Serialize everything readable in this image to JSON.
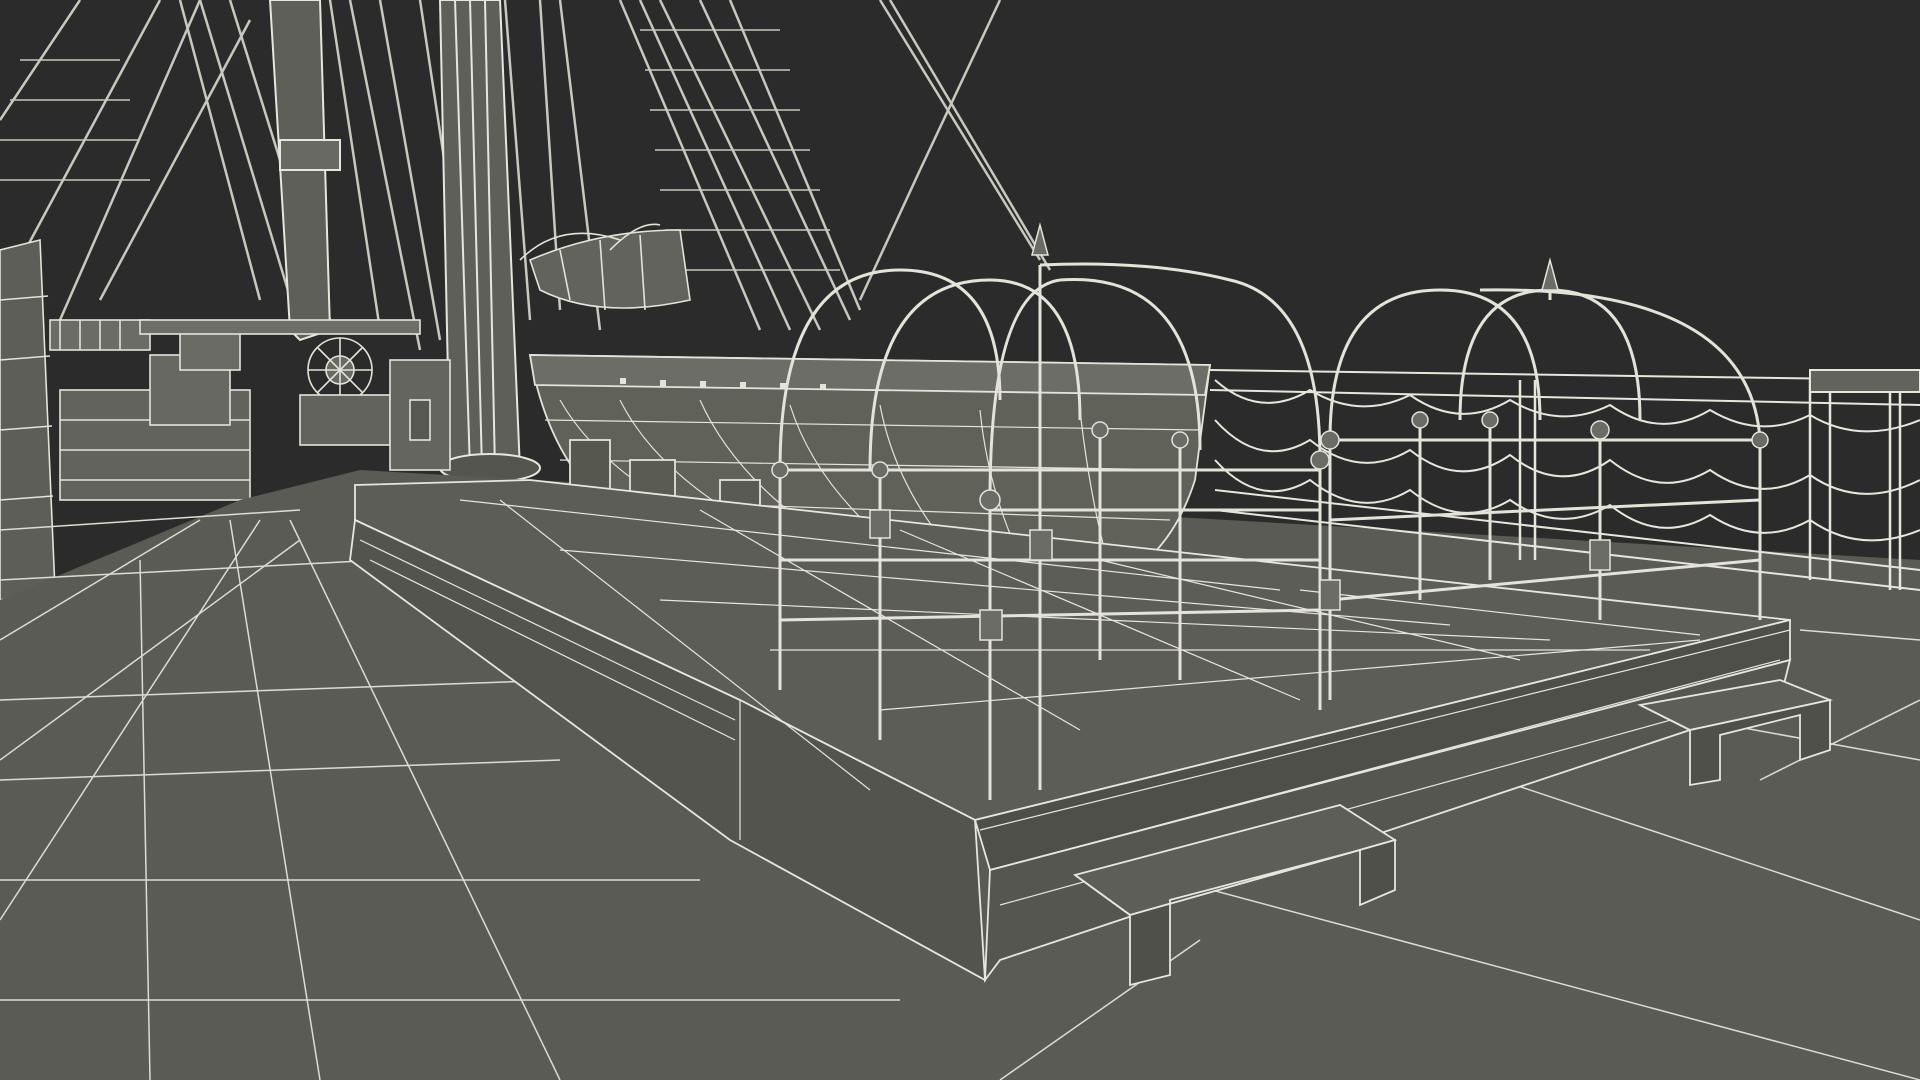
{
  "scene": {
    "subject": "ship-deck-wireframe",
    "colors": {
      "background": "#2b2b2b",
      "deck": "#5b5c55",
      "deck_dark": "#4a4b45",
      "wire": "#e8e8e0",
      "wire_dim": "#b9bab0",
      "metal": "#6a6b64"
    }
  }
}
